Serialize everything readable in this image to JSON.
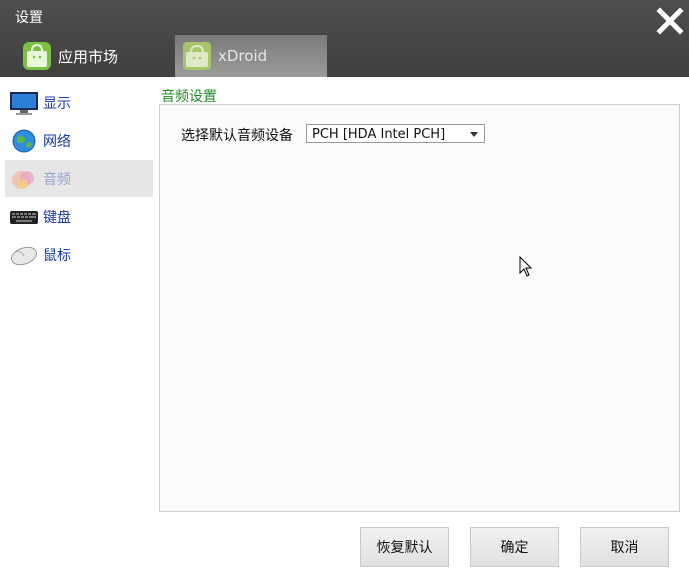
{
  "window": {
    "title": "设置",
    "close_icon": "close-x-icon"
  },
  "tabs": [
    {
      "label": "应用市场",
      "icon": "android-bag-icon",
      "active": false
    },
    {
      "label": "xDroid",
      "icon": "android-bag-icon",
      "active": true
    }
  ],
  "sidebar": {
    "items": [
      {
        "label": "显示",
        "icon": "monitor-icon",
        "active": false
      },
      {
        "label": "网络",
        "icon": "globe-icon",
        "active": false
      },
      {
        "label": "音频",
        "icon": "audio-icon",
        "active": true
      },
      {
        "label": "键盘",
        "icon": "keyboard-icon",
        "active": false
      },
      {
        "label": "鼠标",
        "icon": "mouse-icon",
        "active": false
      }
    ]
  },
  "main": {
    "section_title": "音频设置",
    "device_label": "选择默认音频设备",
    "device_value": "PCH [HDA Intel PCH]"
  },
  "buttons": {
    "restore_label": "恢复默认",
    "ok_label": "确定",
    "cancel_label": "取消"
  },
  "colors": {
    "titlebar": "#474747",
    "section_title": "#1e8c1e",
    "sidebar_text": "#1a3aa8",
    "active_item_bg": "#e6e6e6"
  }
}
